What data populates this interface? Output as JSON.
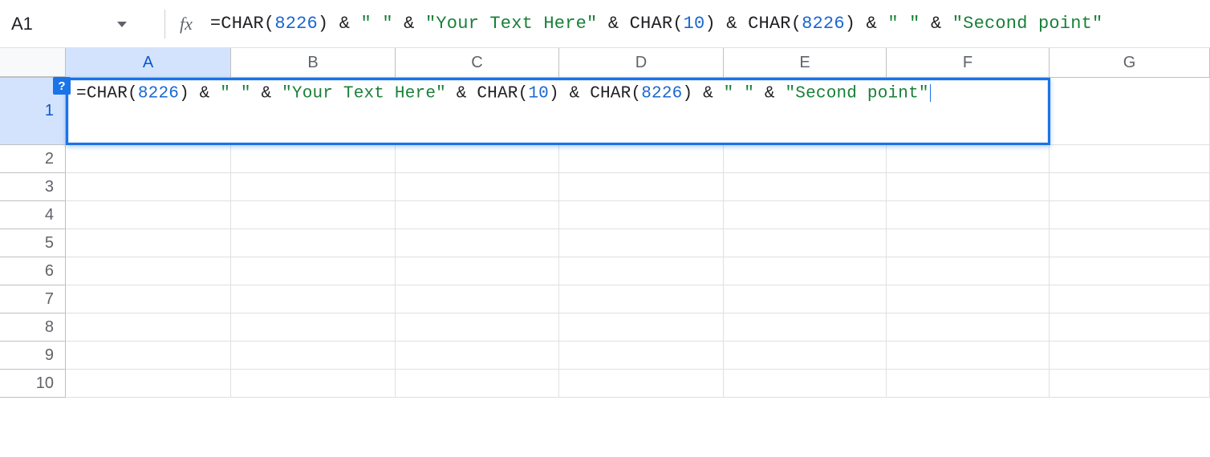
{
  "name_box": {
    "value": "A1"
  },
  "fx_label": "fx",
  "help_tab": "?",
  "columns": [
    "A",
    "B",
    "C",
    "D",
    "E",
    "F",
    "G"
  ],
  "selected_column_index": 0,
  "rows": [
    "1",
    "2",
    "3",
    "4",
    "5",
    "6",
    "7",
    "8",
    "9",
    "10"
  ],
  "selected_row_index": 0,
  "formula_tokens": [
    {
      "t": "op",
      "v": "="
    },
    {
      "t": "fn",
      "v": "CHAR"
    },
    {
      "t": "op",
      "v": "("
    },
    {
      "t": "num",
      "v": "8226"
    },
    {
      "t": "op",
      "v": ")"
    },
    {
      "t": "op",
      "v": " & "
    },
    {
      "t": "str",
      "v": "\" \""
    },
    {
      "t": "op",
      "v": " & "
    },
    {
      "t": "str",
      "v": "\"Your Text Here\""
    },
    {
      "t": "op",
      "v": " & "
    },
    {
      "t": "fn",
      "v": "CHAR"
    },
    {
      "t": "op",
      "v": "("
    },
    {
      "t": "num",
      "v": "10"
    },
    {
      "t": "op",
      "v": ")"
    },
    {
      "t": "op",
      "v": " & "
    },
    {
      "t": "fn",
      "v": "CHAR"
    },
    {
      "t": "op",
      "v": "("
    },
    {
      "t": "num",
      "v": "8226"
    },
    {
      "t": "op",
      "v": ")"
    },
    {
      "t": "op",
      "v": " & "
    },
    {
      "t": "str",
      "v": "\" \""
    },
    {
      "t": "op",
      "v": " & "
    },
    {
      "t": "str",
      "v": "\"Second point\""
    }
  ]
}
